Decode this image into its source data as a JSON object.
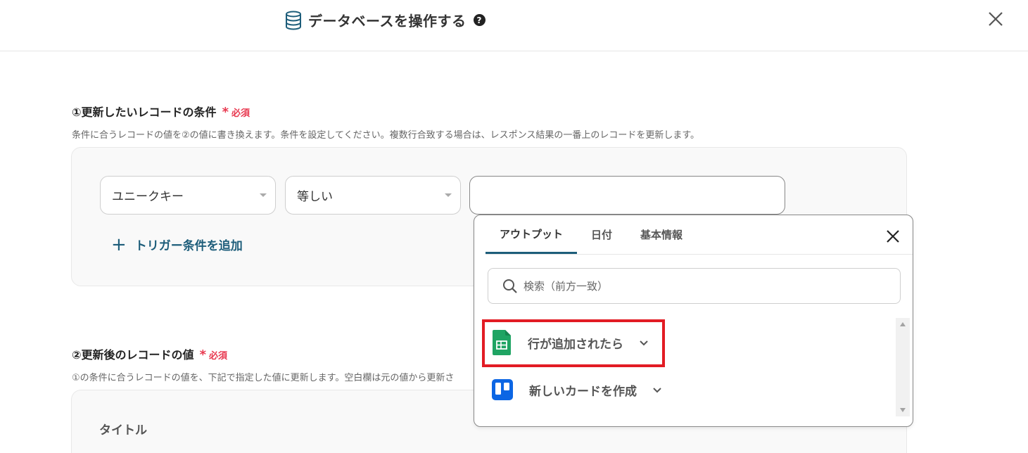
{
  "header": {
    "title": "データベースを操作する",
    "help_icon": "?",
    "icon": "database-icon"
  },
  "section1": {
    "title": "①更新したいレコードの条件",
    "required_mark": "*",
    "required_text": "必須",
    "description": "条件に合うレコードの値を②の値に書き換えます。条件を設定してください。複数行合致する場合は、レスポンス結果の一番上のレコードを更新します。",
    "field_select": "ユニークキー",
    "operator_select": "等しい",
    "value_input": "",
    "add_trigger": "トリガー条件を追加",
    "add_icon": "+"
  },
  "section2": {
    "title": "②更新後のレコードの値",
    "required_mark": "*",
    "required_text": "必須",
    "description": "①の条件に合うレコードの値を、下記で指定した値に更新します。空白欄は元の値から更新さ",
    "field_label": "タイトル"
  },
  "popup": {
    "tabs": [
      {
        "label": "アウトプット",
        "active": true
      },
      {
        "label": "日付",
        "active": false
      },
      {
        "label": "基本情報",
        "active": false
      }
    ],
    "search_placeholder": "検索（前方一致）",
    "items": [
      {
        "label": "行が追加されたら",
        "icon": "google-sheets-icon",
        "highlighted": true
      },
      {
        "label": "新しいカードを作成",
        "icon": "trello-icon",
        "highlighted": false
      }
    ]
  },
  "colors": {
    "accent": "#1d5d7a",
    "required": "#e8384f",
    "highlight_border": "#e21c24",
    "sheets_green": "#1fa463",
    "trello_blue": "#0c66e4"
  }
}
